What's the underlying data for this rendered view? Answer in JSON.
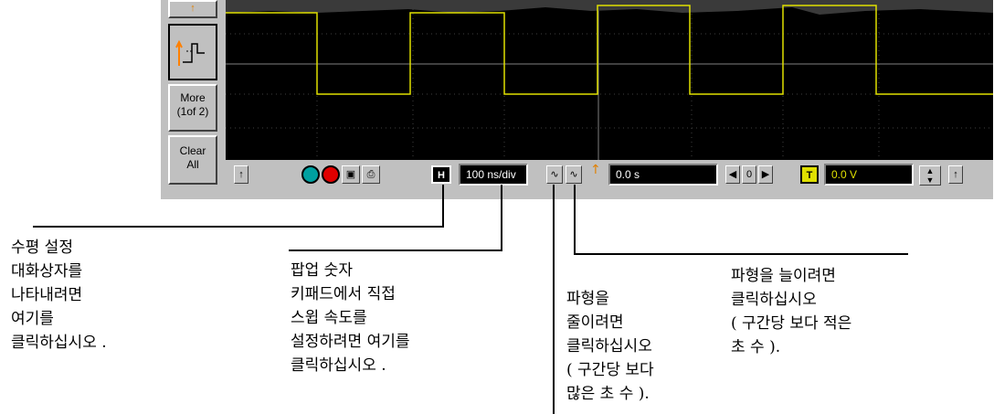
{
  "left_panel": {
    "more_label_1": "More",
    "more_label_2": "(1of 2)",
    "clear_label_1": "Clear",
    "clear_label_2": "All",
    "mode_icon": "step-waveform-icon"
  },
  "toolbar": {
    "run_icon": "run-circle-icon",
    "stop_icon": "stop-circle-icon",
    "autoscale_icon": "autoscale-icon",
    "print_icon": "printer-icon",
    "h_label": "H",
    "timebase_value": "100 ns/div",
    "zoom_in_icon": "waveform-compress-icon",
    "zoom_out_icon": "waveform-expand-icon",
    "delay_value": "0.0 s",
    "delay_zero": "0",
    "trigger_label": "T",
    "trigger_value": "0.0 V"
  },
  "colors": {
    "trace": "#e0e000",
    "scope_bg": "#000000",
    "run": "#00a0a0",
    "stop": "#e00000"
  },
  "callouts": {
    "horizontal": "수평 설정\n대화상자를\n나타내려면\n여기를\n클릭하십시오 .",
    "keypad": "팝업 숫자\n키패드에서 직접\n스윕 속도를\n설정하려면 여기를\n클릭하십시오 .",
    "compress": "파형을\n줄이려면\n클릭하십시오\n( 구간당 보다\n많은 초 수 ).",
    "expand": "파형을 늘이려면\n클릭하십시오\n( 구간당 보다 적은\n초 수 )."
  }
}
